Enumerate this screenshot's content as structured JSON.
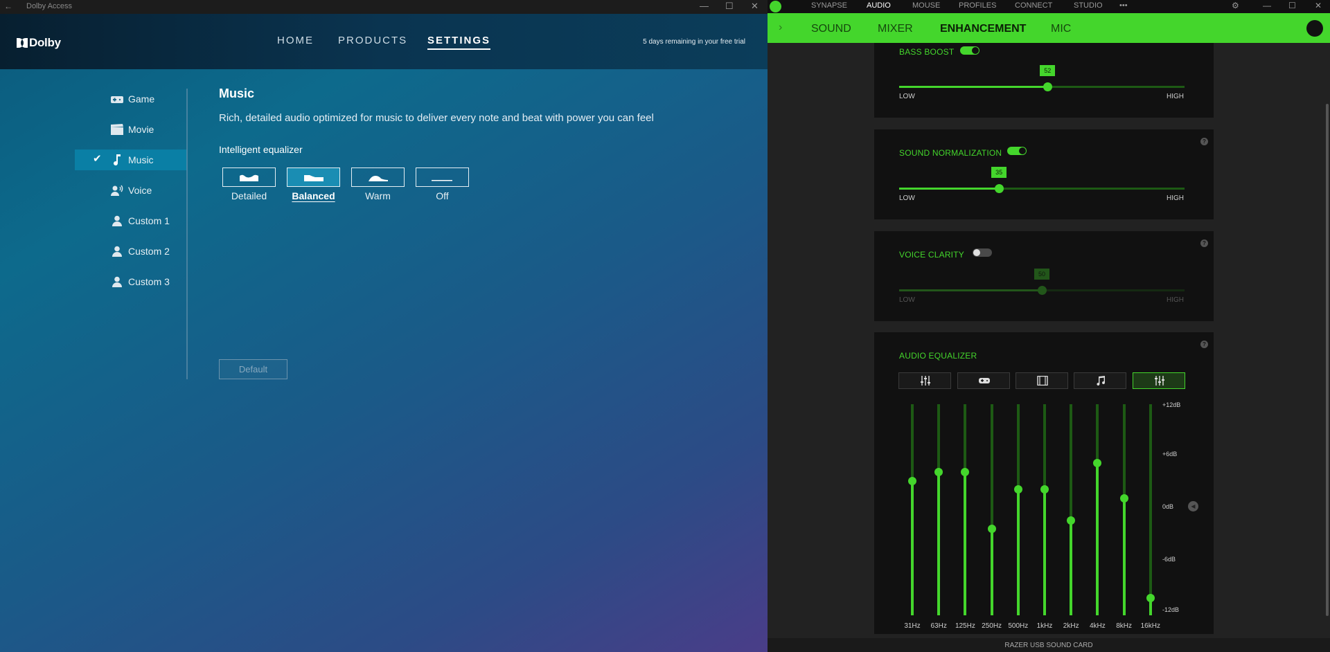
{
  "dolby": {
    "window_title": "Dolby Access",
    "logo": "Dolby",
    "nav": [
      "HOME",
      "PRODUCTS",
      "SETTINGS"
    ],
    "trial": "5 days remaining in your free trial",
    "sidebar": [
      {
        "label": "Game",
        "icon": "gamepad-icon"
      },
      {
        "label": "Movie",
        "icon": "clapperboard-icon"
      },
      {
        "label": "Music",
        "icon": "music-note-icon"
      },
      {
        "label": "Voice",
        "icon": "voice-icon"
      },
      {
        "label": "Custom 1",
        "icon": "person-icon"
      },
      {
        "label": "Custom 2",
        "icon": "person-icon"
      },
      {
        "label": "Custom 3",
        "icon": "person-icon"
      }
    ],
    "selected_profile": "Music",
    "title": "Music",
    "description": "Rich, detailed audio optimized for music to deliver every note and beat with power you can feel",
    "eq_label": "Intelligent equalizer",
    "presets": [
      "Detailed",
      "Balanced",
      "Warm",
      "Off"
    ],
    "selected_preset": "Balanced",
    "default_button": "Default"
  },
  "razer": {
    "top_tabs": [
      "SYNAPSE",
      "AUDIO",
      "MOUSE",
      "PROFILES",
      "CONNECT",
      "STUDIO"
    ],
    "active_top_tab": "AUDIO",
    "sub_tabs": [
      "SOUND",
      "MIXER",
      "ENHANCEMENT",
      "MIC"
    ],
    "active_sub_tab": "ENHANCEMENT",
    "bass_boost": {
      "title": "BASS BOOST",
      "value": "52",
      "level": 52,
      "enabled": true,
      "low": "LOW",
      "high": "HIGH"
    },
    "sound_normalization": {
      "title": "SOUND NORMALIZATION",
      "value": "35",
      "level": 35,
      "enabled": true,
      "low": "LOW",
      "high": "HIGH"
    },
    "voice_clarity": {
      "title": "VOICE CLARITY",
      "value": "50",
      "level": 50,
      "enabled": false,
      "low": "LOW",
      "high": "HIGH"
    },
    "eq_title": "AUDIO EQUALIZER",
    "eq_presets": [
      "sliders-icon",
      "gamepad-icon",
      "film-icon",
      "music-note-icon",
      "custom-sliders-icon"
    ],
    "eq_bands": [
      "31Hz",
      "63Hz",
      "125Hz",
      "250Hz",
      "500Hz",
      "1kHz",
      "2kHz",
      "4kHz",
      "8kHz",
      "16kHz"
    ],
    "eq_levels_db": [
      3.3,
      4.3,
      4.3,
      -2.2,
      2.3,
      2.3,
      -1.2,
      5.3,
      1.3,
      -10.0
    ],
    "db_labels": [
      "+12dB",
      "+6dB",
      "0dB",
      "-6dB",
      "-12dB"
    ],
    "device": "RAZER USB SOUND CARD"
  }
}
